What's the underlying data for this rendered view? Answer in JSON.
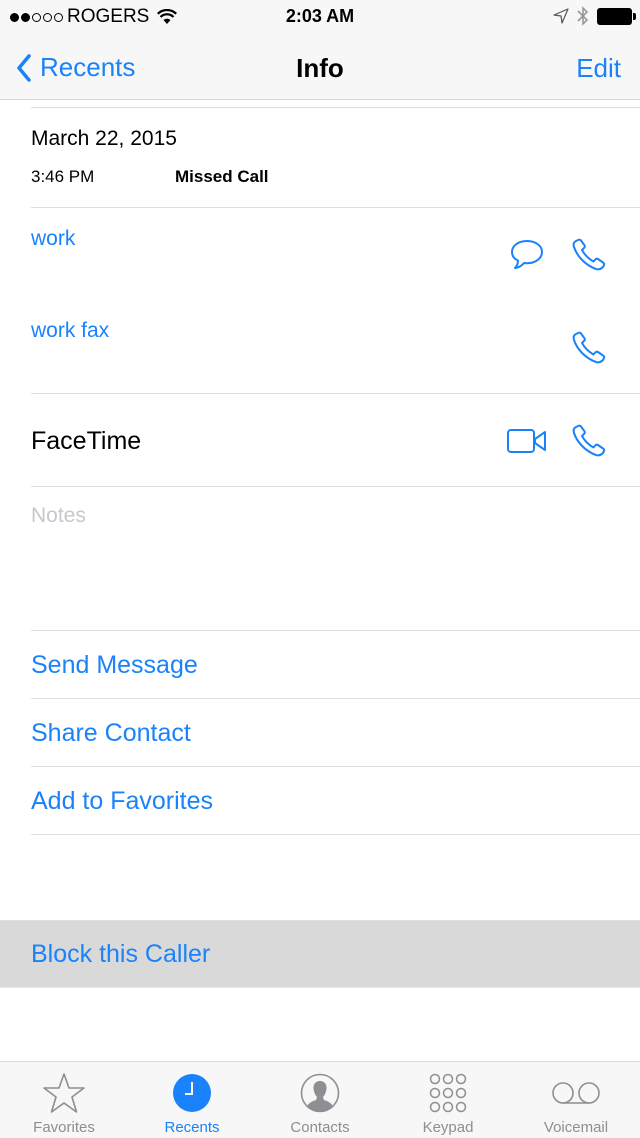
{
  "status_bar": {
    "signal_bars_filled": 2,
    "signal_bars_total": 5,
    "carrier": "ROGERS",
    "time": "2:03 AM",
    "icons": [
      "wifi-icon",
      "location-icon",
      "bluetooth-icon",
      "battery-icon"
    ]
  },
  "nav": {
    "back_label": "Recents",
    "title": "Info",
    "edit_label": "Edit"
  },
  "call_log": {
    "date": "March 22, 2015",
    "time": "3:46 PM",
    "type": "Missed Call"
  },
  "contact_rows": [
    {
      "label": "work",
      "actions": [
        "message-icon",
        "phone-icon"
      ]
    },
    {
      "label": "work fax",
      "actions": [
        "phone-icon"
      ]
    }
  ],
  "facetime": {
    "label": "FaceTime",
    "actions": [
      "video-icon",
      "phone-icon"
    ]
  },
  "notes": {
    "placeholder": "Notes"
  },
  "actions": [
    {
      "label": "Send Message"
    },
    {
      "label": "Share Contact"
    },
    {
      "label": "Add to Favorites"
    }
  ],
  "block": {
    "label": "Block this Caller"
  },
  "tabs": [
    {
      "label": "Favorites",
      "icon": "star-icon",
      "active": false
    },
    {
      "label": "Recents",
      "icon": "clock-icon",
      "active": true
    },
    {
      "label": "Contacts",
      "icon": "contact-icon",
      "active": false
    },
    {
      "label": "Keypad",
      "icon": "keypad-icon",
      "active": false
    },
    {
      "label": "Voicemail",
      "icon": "voicemail-icon",
      "active": false
    }
  ],
  "colors": {
    "accent": "#1a82fb",
    "tab_inactive": "#8e8e93",
    "highlight_row": "#d9d9d9",
    "placeholder": "#c7c7cd"
  }
}
